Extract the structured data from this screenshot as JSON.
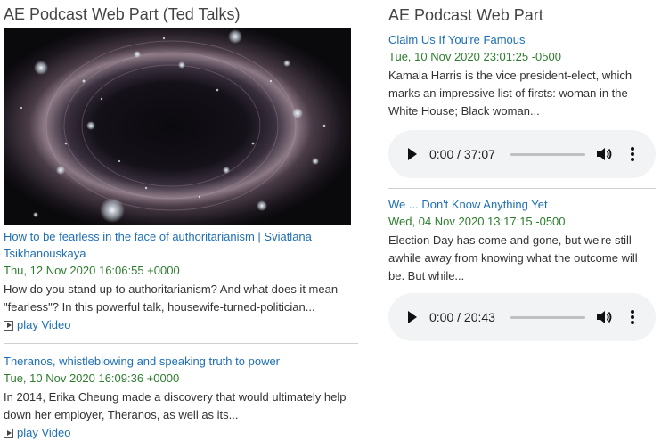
{
  "left_part": {
    "title": "AE Podcast Web Part (Ted Talks)",
    "items": [
      {
        "title": "How to be fearless in the face of authoritarianism | Sviatlana Tsikhanouskaya",
        "date": "Thu, 12 Nov 2020 16:06:55 +0000",
        "description": "How do you stand up to authoritarianism? And what does it mean \"fearless\"? In this powerful talk, housewife-turned-politician...",
        "play_label": "play Video",
        "thumbnail_icon": "video-thumbnail-image"
      },
      {
        "title": "Theranos, whistleblowing and speaking truth to power",
        "date": "Tue, 10 Nov 2020 16:09:36 +0000",
        "description": "In 2014, Erika Cheung made a discovery that would ultimately help down her employer, Theranos, as well as its...",
        "play_label": "play Video"
      }
    ]
  },
  "right_part": {
    "title": "AE Podcast Web Part",
    "items": [
      {
        "title": "Claim Us If You're Famous",
        "date": "Tue, 10 Nov 2020 23:01:25 -0500",
        "description": "Kamala Harris is the vice president-elect, which marks an impressive list of firsts: woman in the White House; Black woman...",
        "audio_time": "0:00 / 37:07"
      },
      {
        "title": "We ... Don't Know Anything Yet",
        "date": "Wed, 04 Nov 2020 13:17:15 -0500",
        "description": "Election Day has come and gone, but we're still awhile away from knowing what the outcome will be. But while...",
        "audio_time": "0:00 / 20:43"
      }
    ]
  },
  "colors": {
    "link": "#1e6fb4",
    "date": "#2e7d2e",
    "text": "#333333",
    "audio_bg": "#f1f3f4"
  }
}
